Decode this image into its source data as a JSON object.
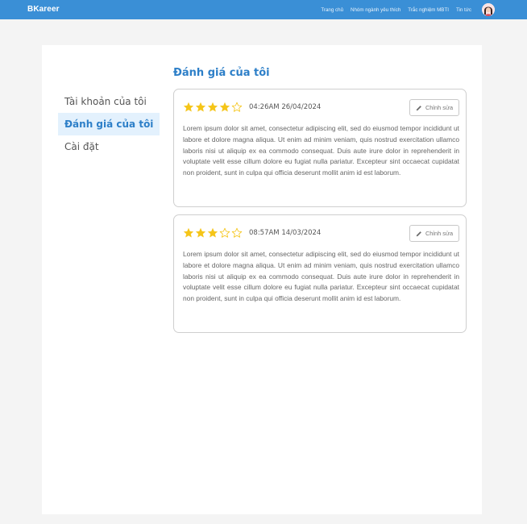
{
  "header": {
    "brand": "BKareer",
    "nav": [
      "Trang chủ",
      "Nhóm ngành yêu thích",
      "Trắc nghiệm MBTI",
      "Tin tức"
    ]
  },
  "sidebar": {
    "items": [
      {
        "label": "Tài khoản của tôi",
        "active": false
      },
      {
        "label": "Đánh giá của tôi",
        "active": true
      },
      {
        "label": "Cài đặt",
        "active": false
      }
    ]
  },
  "main": {
    "title": "Đánh giá của tôi",
    "reviews": [
      {
        "rating": 4,
        "max_rating": 5,
        "date": "04:26AM 26/04/2024",
        "edit_label": "Chỉnh sửa",
        "text": "Lorem ipsum dolor sit amet, consectetur adipiscing elit, sed do eiusmod tempor incididunt ut labore et dolore magna aliqua. Ut enim ad minim veniam, quis nostrud exercitation ullamco laboris nisi ut aliquip ex ea commodo consequat. Duis aute irure dolor in reprehenderit in voluptate velit esse cillum dolore eu fugiat nulla pariatur. Excepteur sint occaecat cupidatat non proident, sunt in culpa qui officia deserunt mollit anim id est laborum."
      },
      {
        "rating": 3,
        "max_rating": 5,
        "date": "08:57AM 14/03/2024",
        "edit_label": "Chỉnh sửa",
        "text": "Lorem ipsum dolor sit amet, consectetur adipiscing elit, sed do eiusmod tempor incididunt ut labore et dolore magna aliqua. Ut enim ad minim veniam, quis nostrud exercitation ullamco laboris nisi ut aliquip ex ea commodo consequat. Duis aute irure dolor in reprehenderit in voluptate velit esse cillum dolore eu fugiat nulla pariatur. Excepteur sint occaecat cupidatat non proident, sunt in culpa qui officia deserunt mollit anim id est laborum."
      }
    ]
  },
  "colors": {
    "header_bg": "#3a8fd6",
    "accent": "#2d7fc8",
    "star_filled": "#f5c518",
    "star_empty": "#f5c518"
  },
  "icons": {
    "avatar": "user-avatar-icon",
    "star": "star-icon",
    "edit": "pencil-icon"
  }
}
